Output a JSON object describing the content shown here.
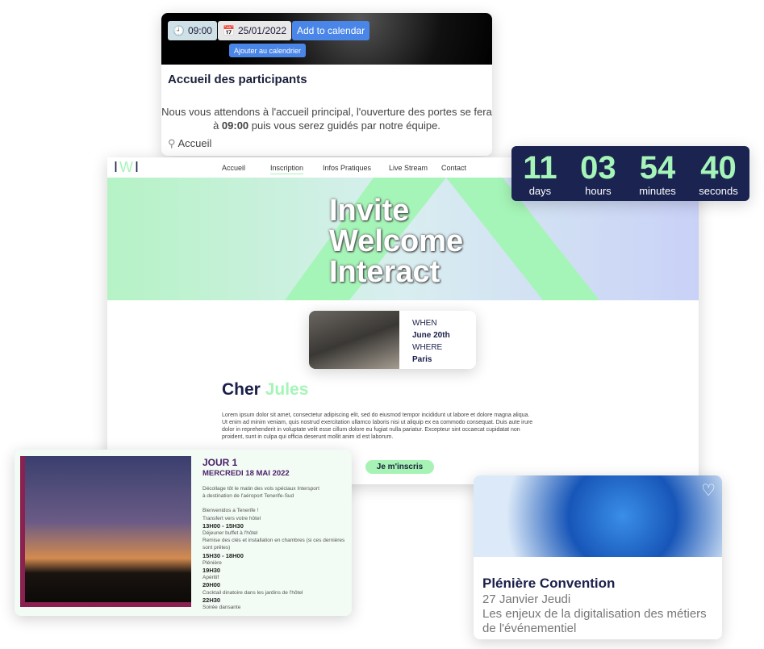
{
  "top_card": {
    "time": "09:00",
    "date": "25/01/2022",
    "add_calendar": "Add to calendar",
    "add_calendar_fr": "Ajouter au calendrier",
    "title": "Accueil des participants",
    "text_before": "Nous vous attendons à l'accueil principal, l'ouverture des portes se fera à ",
    "text_time": "09:00",
    "text_after": " puis vous serez guidés par notre équipe.",
    "location": "Accueil"
  },
  "site": {
    "logo": "IWI",
    "nav": [
      "Accueil",
      "Inscription",
      "Infos Pratiques",
      "Live Stream",
      "Contact"
    ],
    "active_nav": "Inscription",
    "accent": "#a6f5b8",
    "hero": [
      "Invite",
      "Welcome",
      "Interact"
    ],
    "event": {
      "when_label": "WHEN",
      "when": "June 20th",
      "where_label": "WHERE",
      "where": "Paris"
    },
    "greeting": "Cher",
    "name": "Jules",
    "lorem": "Lorem ipsum dolor sit amet, consectetur adipiscing elit, sed do eiusmod tempor incididunt ut labore et dolore magna aliqua. Ut enim ad minim veniam, quis nostrud exercitation ullamco laboris nisi ut aliquip ex ea commodo consequat. Duis aute irure dolor in reprehenderit in voluptate velit esse cillum dolore eu fugiat nulla pariatur. Excepteur sint occaecat cupidatat non proident, sunt in culpa qui officia deserunt mollit anim id est laborum.",
    "cta": "Je m'inscris"
  },
  "countdown": [
    {
      "n": "11",
      "l": "days"
    },
    {
      "n": "03",
      "l": "hours"
    },
    {
      "n": "54",
      "l": "minutes"
    },
    {
      "n": "40",
      "l": "seconds"
    }
  ],
  "day": {
    "title": "JOUR 1",
    "date": "MERCREDI 18 MAI 2022",
    "intro": [
      "Décollage tôt le matin des vols spéciaux Intersport",
      "à destination de l'aéroport Tenerife-Sud"
    ],
    "lines": [
      {
        "t": "Bienvenidos a Tenerife !"
      },
      {
        "t": "Transfert vers votre hôtel"
      },
      {
        "b": "13H00 - 15H30"
      },
      {
        "t": "Déjeuner buffet à l'hôtel"
      },
      {
        "t": "Remise des clés et installation en chambres (si ces dernières sont prêtes)"
      },
      {
        "b": "15H30 - 18H00"
      },
      {
        "t": "Plénière"
      },
      {
        "b": "19H30"
      },
      {
        "t": "Apéritif"
      },
      {
        "b": "20H00"
      },
      {
        "t": "Cocktail dinatoire dans les jardins de l'hôtel"
      },
      {
        "b": "22H30"
      },
      {
        "t": "Soirée dansante"
      }
    ]
  },
  "plenary": {
    "title": "Plénière Convention",
    "date": "27 Janvier Jeudi",
    "subtitle": "Les enjeux de la digitalisation des métiers de l'événementiel",
    "icon": "heart-icon"
  }
}
